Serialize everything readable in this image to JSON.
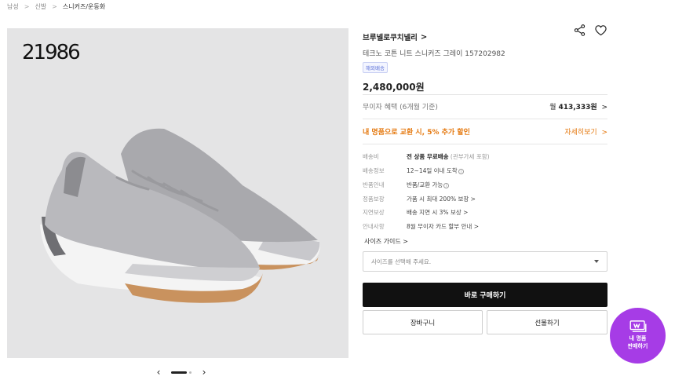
{
  "breadcrumb": [
    "남성",
    "신발",
    "스니커즈/운동화"
  ],
  "gallery": {
    "watermark": "21986"
  },
  "product": {
    "brand": "브루넬로쿠치넬리",
    "name": "테크노 코튼 니트 스니커즈 그레이 157202982",
    "badge": "해외배송",
    "price": "2,480,000원"
  },
  "installment": {
    "label": "무이자 혜택",
    "sub": "(6개월 기준)",
    "prefix": "월",
    "amount": "413,333원"
  },
  "trade_in": {
    "label": "내 명품으로 교환 시, 5% 추가 할인",
    "link": "자세히보기"
  },
  "specs": [
    {
      "key": "배송비",
      "bold": "전 상품 무료배송",
      "sub": "(관부가세 포함)"
    },
    {
      "key": "배송정보",
      "value": "12~14일 이내 도착"
    },
    {
      "key": "반품안내",
      "value": "반품/교환 가능"
    },
    {
      "key": "정품보장",
      "value": "가품 시 최대 200% 보장"
    },
    {
      "key": "지연보상",
      "value": "배송 지연 시 3% 보상"
    },
    {
      "key": "안내사항",
      "value": "8월 무이자 카드 할부 안내"
    }
  ],
  "size": {
    "guide": "사이즈 가이드",
    "placeholder": "사이즈를 선택해 주세요."
  },
  "actions": {
    "buy": "바로 구매하기",
    "cart": "장바구니",
    "gift": "선물하기"
  },
  "fab": {
    "line1": "내 명품",
    "line2": "판매하기"
  },
  "colors": {
    "accent_orange": "#e57a12",
    "fab_purple": "#a63ce6",
    "buy_black": "#111111"
  }
}
